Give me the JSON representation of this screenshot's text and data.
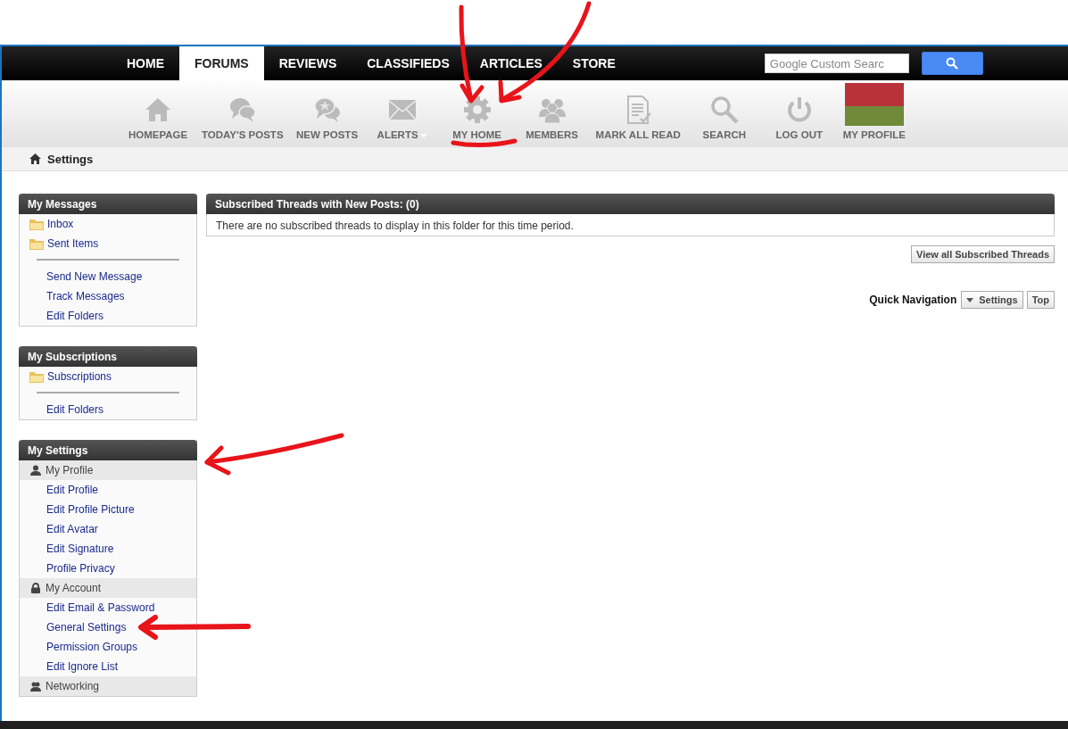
{
  "nav_tabs": [
    {
      "label": "HOME",
      "selected": false
    },
    {
      "label": "FORUMS",
      "selected": true
    },
    {
      "label": "REVIEWS",
      "selected": false
    },
    {
      "label": "CLASSIFIEDS",
      "selected": false
    },
    {
      "label": "ARTICLES",
      "selected": false
    },
    {
      "label": "STORE",
      "selected": false
    }
  ],
  "search": {
    "placeholder": "Google Custom Searc"
  },
  "toolbar": [
    {
      "label": "HOMEPAGE",
      "kind": "house"
    },
    {
      "label": "TODAY'S POSTS",
      "kind": "chat"
    },
    {
      "label": "NEW POSTS",
      "kind": "chat-star"
    },
    {
      "label": "ALERTS",
      "kind": "mail",
      "dropdown": true
    },
    {
      "label": "MY HOME",
      "kind": "gear"
    },
    {
      "label": "MEMBERS",
      "kind": "people"
    },
    {
      "label": "MARK ALL READ",
      "kind": "doc"
    },
    {
      "label": "SEARCH",
      "kind": "search"
    },
    {
      "label": "LOG OUT",
      "kind": "power"
    },
    {
      "label": "MY PROFILE",
      "kind": "photo"
    }
  ],
  "breadcrumb": "Settings",
  "sidebar": [
    {
      "title": "My Messages",
      "items": [
        {
          "kind": "folder",
          "label": "Inbox"
        },
        {
          "kind": "folder",
          "label": "Sent Items"
        },
        {
          "kind": "divider"
        },
        {
          "kind": "link",
          "label": "Send New Message"
        },
        {
          "kind": "link",
          "label": "Track Messages"
        },
        {
          "kind": "link",
          "label": "Edit Folders"
        }
      ]
    },
    {
      "title": "My Subscriptions",
      "items": [
        {
          "kind": "folder",
          "label": "Subscriptions"
        },
        {
          "kind": "divider"
        },
        {
          "kind": "link",
          "label": "Edit Folders"
        }
      ]
    },
    {
      "title": "My Settings",
      "items": [
        {
          "kind": "person",
          "label": "My Profile"
        },
        {
          "kind": "link",
          "label": "Edit Profile"
        },
        {
          "kind": "link",
          "label": "Edit Profile Picture"
        },
        {
          "kind": "link",
          "label": "Edit Avatar"
        },
        {
          "kind": "link",
          "label": "Edit Signature"
        },
        {
          "kind": "link",
          "label": "Profile Privacy"
        },
        {
          "kind": "lock",
          "label": "My Account"
        },
        {
          "kind": "link",
          "label": "Edit Email & Password"
        },
        {
          "kind": "link",
          "label": "General Settings"
        },
        {
          "kind": "link",
          "label": "Permission Groups"
        },
        {
          "kind": "link",
          "label": "Edit Ignore List"
        },
        {
          "kind": "people",
          "label": "Networking"
        }
      ]
    }
  ],
  "panel": {
    "title": "Subscribed Threads with New Posts: (0)",
    "message": "There are no subscribed threads to display in this folder for this time period.",
    "button": "View all Subscribed Threads"
  },
  "quick_nav": {
    "label": "Quick Navigation",
    "dropdown": "Settings",
    "button": "Top"
  }
}
